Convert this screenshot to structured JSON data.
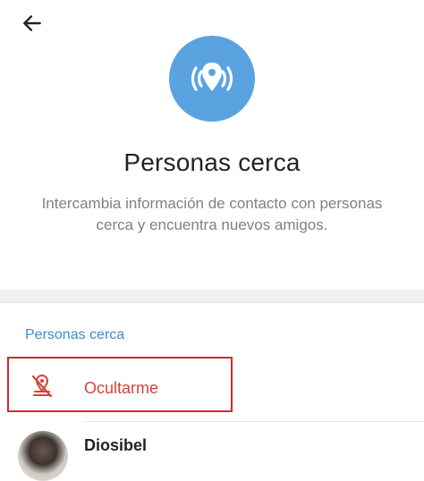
{
  "header": {
    "back_icon": "arrow-left-icon"
  },
  "hero": {
    "icon": "location-broadcast-icon",
    "icon_bg_color": "#5aa3e0",
    "title": "Personas cerca",
    "description": "Intercambia información de contacto con personas cerca y encuentra nuevos amigos."
  },
  "section": {
    "header": "Personas cerca",
    "header_color": "#3a8fc8"
  },
  "hide_option": {
    "icon": "location-off-icon",
    "label": "Ocultarme",
    "color": "#d9413a"
  },
  "users": [
    {
      "name": "Diosibel"
    }
  ]
}
